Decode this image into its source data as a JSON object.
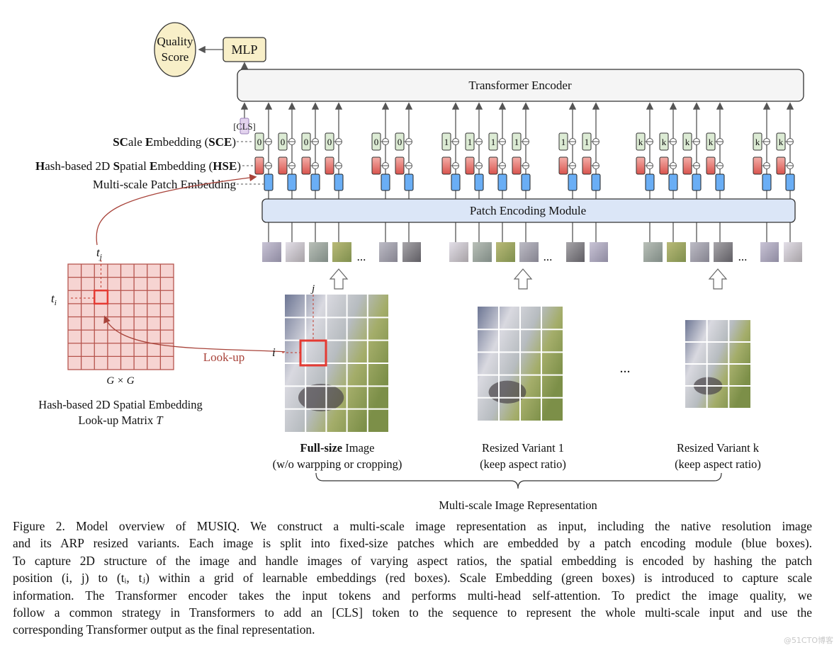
{
  "figure": {
    "quality_score": [
      "Quality",
      "Score"
    ],
    "mlp": "MLP",
    "transformer_encoder": "Transformer Encoder",
    "cls_token": "[CLS]",
    "sce_label": {
      "bold1": "SC",
      "rest1": "ale ",
      "bold2": "E",
      "rest2": "mbedding (",
      "bold3": "SCE",
      "rest3": ")"
    },
    "hse_label": {
      "bold1": "H",
      "rest1": "ash-based 2D ",
      "bold2": "S",
      "rest2": "patial ",
      "bold3": "E",
      "rest3": "mbedding (",
      "bold4": "HSE",
      "rest4": ")"
    },
    "patch_embedding_label": "Multi-scale Patch Embedding",
    "patch_encoding_module": "Patch Encoding Module",
    "scale_groups": [
      {
        "scale_index": "0",
        "tokens": 6
      },
      {
        "scale_index": "1",
        "tokens": 6
      },
      {
        "scale_index": "k",
        "tokens": 6
      }
    ],
    "ellipsis": "...",
    "matrix": {
      "size_label": "G × G",
      "ti": "t",
      "ti_sub": "i",
      "tj": "t",
      "tj_sub": "j",
      "title_line1": "Hash-based 2D Spatial Embedding",
      "title_line2": "Look-up Matrix ",
      "title_symbol": "T"
    },
    "lookup_label": "Look-up",
    "image_i": "i",
    "image_j": "j",
    "images": [
      {
        "title_bold": "Full-size",
        "title_rest": " Image",
        "subtitle": "(w/o warpping or cropping)"
      },
      {
        "title_bold": "",
        "title_rest": "Resized Variant 1",
        "subtitle": "(keep aspect ratio)"
      },
      {
        "title_bold": "",
        "title_rest": "Resized Variant k",
        "subtitle": "(keep aspect ratio)"
      }
    ],
    "multiscale_label": "Multi-scale Image Representation",
    "colors": {
      "scale_embedding": "#dcebd4",
      "spatial_embedding": "#e07a74",
      "patch_embedding": "#6aaef5",
      "patch_module": "#dbe6f7",
      "cls": "#e3d3ee",
      "quality": "#f8efc8",
      "matrix": "#f6d4d2",
      "highlight": "#e53a32",
      "lookup": "#a8433a"
    }
  },
  "caption": [
    "Figure 2. Model overview of MUSIQ. We construct a multi-scale image representation as input, including the native resolution image",
    "and its ARP resized variants. Each image is split into fixed-size patches which are embedded by a patch encoding module (blue boxes).",
    "To capture 2D structure of the image and handle images of varying aspect ratios, the spatial embedding is encoded by hashing the patch",
    "position (i, j) to (tᵢ, tⱼ) within a grid of learnable embeddings (red boxes). Scale Embedding (green boxes) is introduced to capture scale",
    "information. The Transformer encoder takes the input tokens and performs multi-head self-attention. To predict the image quality, we",
    "follow a common strategy in Transformers to add an [CLS] token to the sequence to represent the whole multi-scale input and use the",
    "corresponding Transformer output as the final representation."
  ],
  "watermark": "@51CTO博客"
}
